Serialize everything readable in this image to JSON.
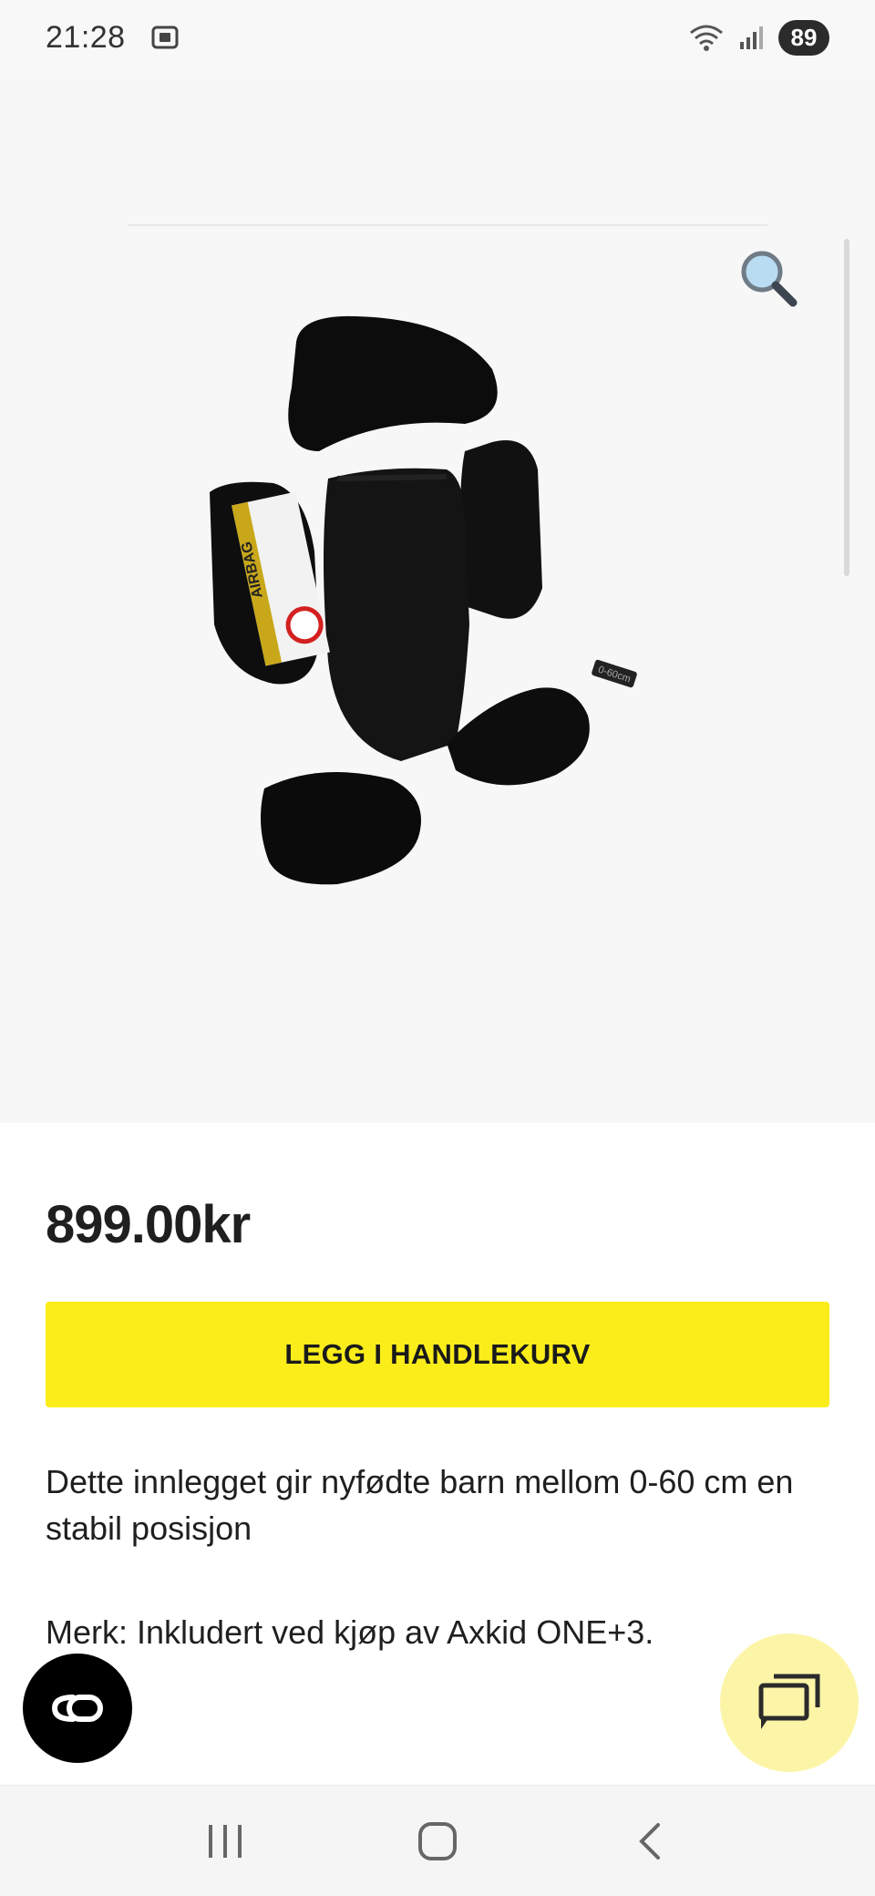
{
  "status_bar": {
    "time": "21:28",
    "battery": "89",
    "icons": [
      "screenshot-icon",
      "wifi-icon",
      "signal-icon"
    ]
  },
  "gallery": {
    "zoom_icon": "magnifier-icon",
    "image_badge": "AIRBAG",
    "image_tag": "0-60cm"
  },
  "product": {
    "price": "899.00kr",
    "add_to_cart_label": "LEGG I HANDLEKURV",
    "description": "Dette innlegget gir nyfødte barn mellom 0-60 cm en stabil posisjon",
    "note": "Merk: Inkludert ved kjøp av Axkid ONE+3."
  },
  "floating": {
    "left_button_icon": "co-icon",
    "right_button_icon": "chat-icon"
  },
  "nav": {
    "recent_icon": "recents-icon",
    "home_icon": "home-icon",
    "back_icon": "back-icon"
  },
  "colors": {
    "accent": "#fbed1a",
    "chat_bg": "#fcf5a8",
    "gallery_bg": "#f7f7f7"
  }
}
